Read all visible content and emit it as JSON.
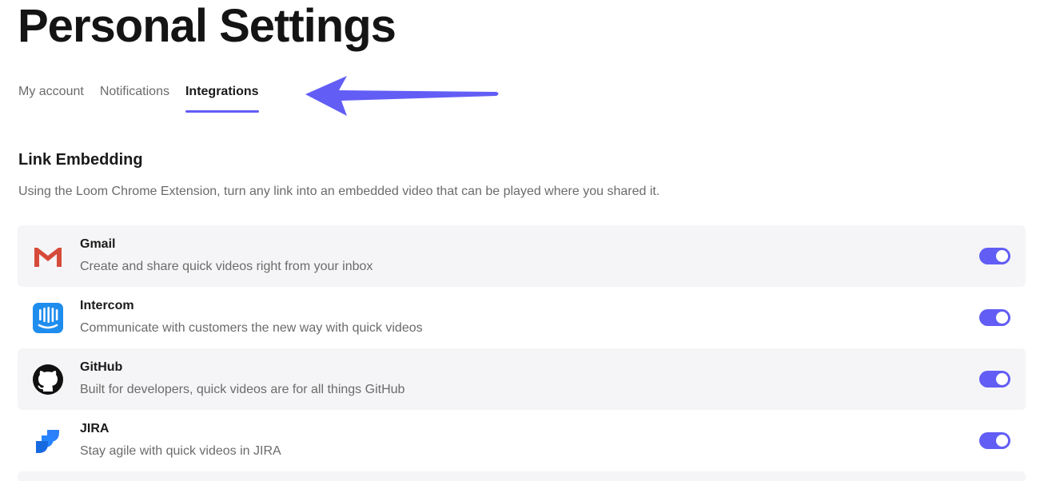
{
  "page": {
    "title": "Personal Settings"
  },
  "tabs": [
    {
      "label": "My account",
      "active": false
    },
    {
      "label": "Notifications",
      "active": false
    },
    {
      "label": "Integrations",
      "active": true
    }
  ],
  "section": {
    "title": "Link Embedding",
    "description": "Using the Loom Chrome Extension, turn any link into an embedded video that can be played where you shared it."
  },
  "integrations": [
    {
      "name": "Gmail",
      "description": "Create and share quick videos right from your inbox",
      "icon": "gmail-icon",
      "enabled": true
    },
    {
      "name": "Intercom",
      "description": "Communicate with customers the new way with quick videos",
      "icon": "intercom-icon",
      "enabled": true
    },
    {
      "name": "GitHub",
      "description": "Built for developers, quick videos are for all things GitHub",
      "icon": "github-icon",
      "enabled": true
    },
    {
      "name": "JIRA",
      "description": "Stay agile with quick videos in JIRA",
      "icon": "jira-icon",
      "enabled": true
    }
  ],
  "colors": {
    "accent": "#625df5",
    "row_shade": "#f5f5f7",
    "muted_text": "#6b6b6b"
  }
}
